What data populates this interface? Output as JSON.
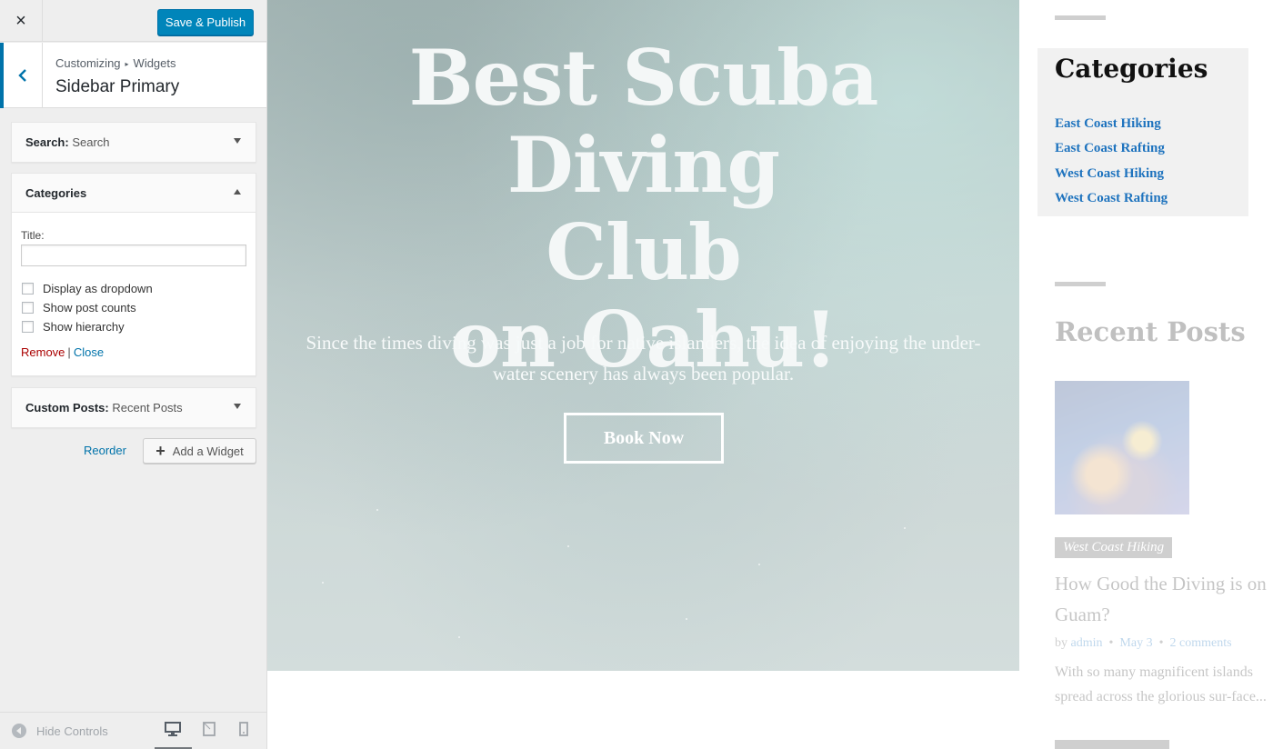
{
  "customizer": {
    "close_icon": "×",
    "save_publish": "Save & Publish",
    "breadcrumb": {
      "root": "Customizing",
      "separator": "▸",
      "section": "Widgets"
    },
    "section_title": "Sidebar Primary",
    "widgets": [
      {
        "name": "Search:",
        "subtitle": "Search",
        "expanded": false
      },
      {
        "name": "Categories",
        "expanded": true,
        "title_label": "Title:",
        "title_value": "",
        "options": [
          {
            "label": "Display as dropdown",
            "checked": false
          },
          {
            "label": "Show post counts",
            "checked": false
          },
          {
            "label": "Show hierarchy",
            "checked": false
          }
        ],
        "remove_label": "Remove",
        "separator": "|",
        "close_label": "Close"
      },
      {
        "name": "Custom Posts:",
        "subtitle": "Recent Posts",
        "expanded": false
      }
    ],
    "reorder_label": "Reorder",
    "add_widget_label": "Add a Widget",
    "hide_controls_label": "Hide Controls",
    "device_buttons": [
      "desktop-icon",
      "tablet-icon",
      "mobile-icon"
    ],
    "active_device": "desktop",
    "accent_color": "#0085ba"
  },
  "preview": {
    "hero": {
      "title_line1": "Best Scuba Diving",
      "title_line2": "Club",
      "title_line3": "on Oahu!",
      "text_line1": "Since the times diving was just a job for native islanders, the idea of enjoying the under-",
      "text_line2": "water scenery has always been popular.",
      "button_label": "Book Now"
    },
    "sidebar": {
      "categories_heading": "Categories",
      "categories": [
        "East Coast Hiking",
        "East Coast Rafting",
        "West Coast Hiking",
        "West Coast Rafting"
      ],
      "recent_posts_heading": "Recent Posts",
      "post": {
        "category": "West Coast Hiking",
        "title": "How Good the Diving is on Guam?",
        "by": "by",
        "author": "admin",
        "meta_separator": "•",
        "date": "May 3",
        "comments": "2 comments",
        "excerpt": "With so many magnificent islands spread across the glorious sur-face..."
      },
      "link_color": "#1e73be"
    }
  }
}
